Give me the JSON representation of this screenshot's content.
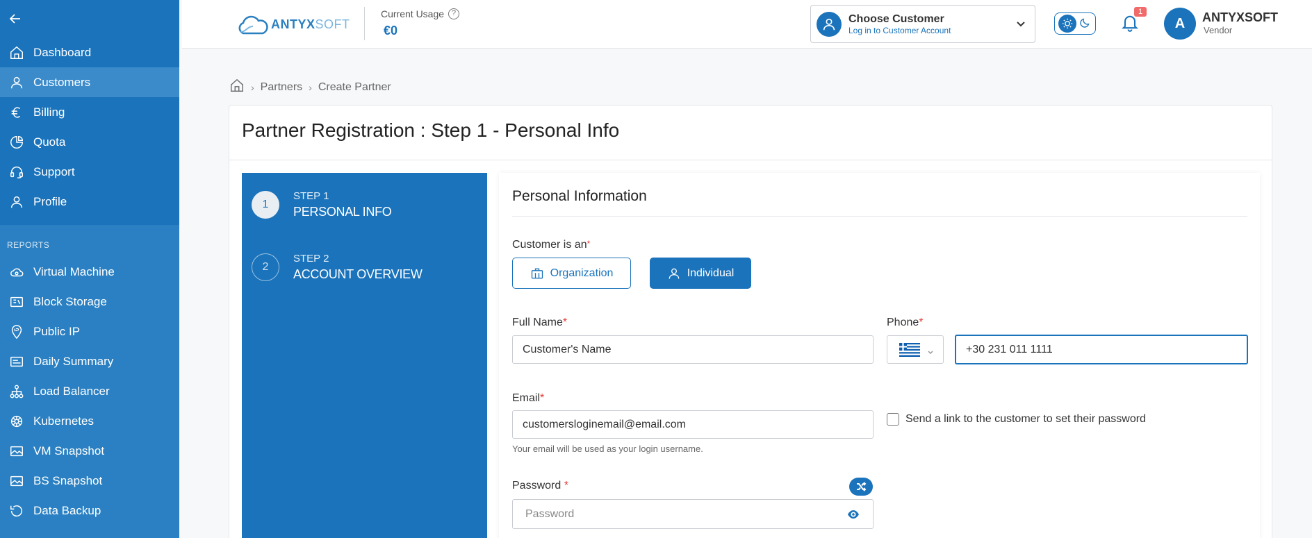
{
  "sidebar": {
    "items": [
      {
        "label": "Dashboard",
        "icon": "home-icon"
      },
      {
        "label": "Customers",
        "icon": "user-icon"
      },
      {
        "label": "Billing",
        "icon": "euro-icon"
      },
      {
        "label": "Quota",
        "icon": "pie-icon"
      },
      {
        "label": "Support",
        "icon": "headset-icon"
      },
      {
        "label": "Profile",
        "icon": "user-icon"
      }
    ],
    "reports_label": "REPORTS",
    "reports": [
      {
        "label": "Virtual Machine",
        "icon": "cloud-icon"
      },
      {
        "label": "Block Storage",
        "icon": "storage-icon"
      },
      {
        "label": "Public IP",
        "icon": "ip-icon"
      },
      {
        "label": "Daily Summary",
        "icon": "summary-icon"
      },
      {
        "label": "Load Balancer",
        "icon": "balancer-icon"
      },
      {
        "label": "Kubernetes",
        "icon": "kubernetes-icon"
      },
      {
        "label": "VM Snapshot",
        "icon": "image-icon"
      },
      {
        "label": "BS Snapshot",
        "icon": "image-icon"
      },
      {
        "label": "Data Backup",
        "icon": "backup-icon"
      }
    ]
  },
  "header": {
    "logo_main": "ANTYX",
    "logo_soft": "SOFT",
    "usage_label": "Current Usage",
    "usage_value": "€0",
    "customer_title": "Choose Customer",
    "customer_sub": "Log in to Customer Account",
    "notif_count": "1",
    "user_initial": "A",
    "user_name": "ANTYXSOFT",
    "user_role": "Vendor"
  },
  "breadcrumb": {
    "items": [
      "Partners",
      "Create Partner"
    ]
  },
  "page": {
    "title": "Partner Registration : Step 1 - Personal Info"
  },
  "steps": [
    {
      "num": "1",
      "step": "STEP 1",
      "name": "PERSONAL INFO"
    },
    {
      "num": "2",
      "step": "STEP 2",
      "name": "ACCOUNT OVERVIEW"
    }
  ],
  "form": {
    "section_title": "Personal Information",
    "customer_type_label": "Customer is an",
    "organization_label": "Organization",
    "individual_label": "Individual",
    "full_name_label": "Full Name",
    "full_name_value": "Customer's Name",
    "phone_label": "Phone",
    "phone_value": "+30 231 011 1111",
    "email_label": "Email",
    "email_value": "customersloginemail@email.com",
    "email_hint": "Your email will be used as your login username.",
    "send_link_label": "Send a link to the customer to set their password",
    "password_label": "Password",
    "password_placeholder": "Password"
  },
  "colors": {
    "primary": "#1a73bb",
    "active": "#3b8bcb",
    "required": "#e53935",
    "badge": "#f26b6b"
  }
}
